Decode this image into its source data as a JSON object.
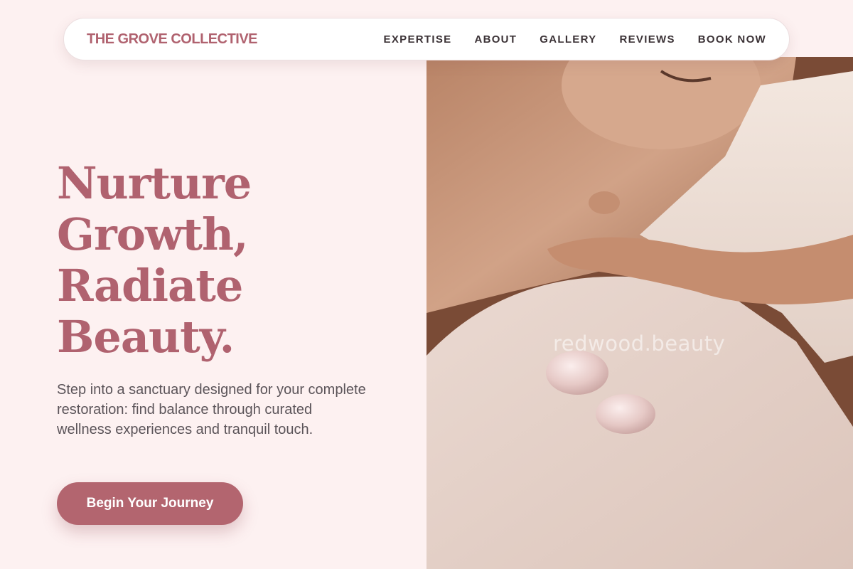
{
  "nav": {
    "brand": "THE GROVE COLLECTIVE",
    "links": [
      "EXPERTISE",
      "ABOUT",
      "GALLERY",
      "REVIEWS",
      "BOOK NOW"
    ]
  },
  "hero": {
    "headline_lines": [
      "Nurture",
      "Growth,",
      "Radiate",
      "Beauty."
    ],
    "lede": "Step into a sanctuary designed for your complete restoration: find balance through curated wellness experiences and tranquil touch.",
    "cta_label": "Begin Your Journey",
    "image_watermark": "redwood.beauty"
  },
  "colors": {
    "background": "#fdf1f1",
    "accent": "#b3656f",
    "brand_text": "#b0626f",
    "body_text": "#5b5459",
    "nav_text": "#3b3236"
  }
}
